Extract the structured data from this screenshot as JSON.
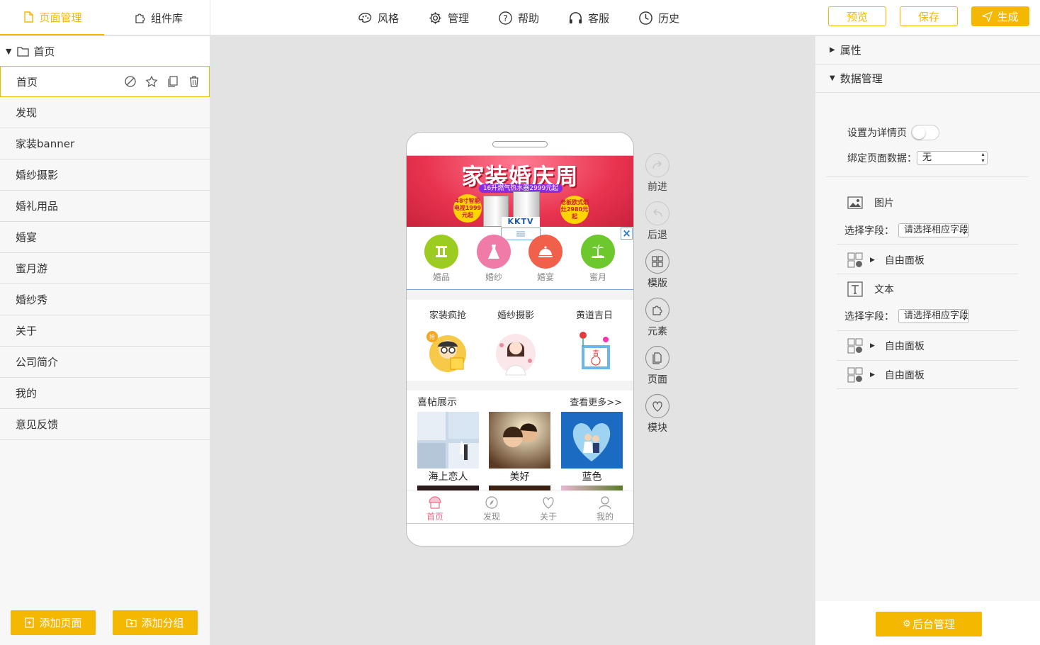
{
  "left_tabs": [
    {
      "label": "页面管理",
      "icon": "file-icon"
    },
    {
      "label": "组件库",
      "icon": "puzzle-icon"
    }
  ],
  "top_nav": [
    {
      "label": "风格",
      "icon": "palette-icon"
    },
    {
      "label": "管理",
      "icon": "gear-icon"
    },
    {
      "label": "帮助",
      "icon": "help-icon"
    },
    {
      "label": "客服",
      "icon": "headset-icon"
    },
    {
      "label": "历史",
      "icon": "clock-icon"
    }
  ],
  "actions": {
    "preview": "预览",
    "save": "保存",
    "generate": "生成"
  },
  "page_tree": {
    "group": "首页",
    "pages": [
      "首页",
      "发现",
      "家装banner",
      "婚纱摄影",
      "婚礼用品",
      "婚宴",
      "蜜月游",
      "婚纱秀",
      "关于",
      "公司简介",
      "我的",
      "意见反馈"
    ],
    "selected": 0
  },
  "left_buttons": {
    "add_page": "添加页面",
    "add_group": "添加分组"
  },
  "phone": {
    "banner": {
      "title": "家装婚庆周",
      "subtitle": "16升燃气热水器2999元起",
      "badge_left": "48寸智能电视1999元起",
      "badge_right": "老板欧式烟灶2980元起",
      "kktv": "KKTV"
    },
    "categories": [
      {
        "label": "婚品",
        "color": "#9ccc1f"
      },
      {
        "label": "婚纱",
        "color": "#f07aa8"
      },
      {
        "label": "婚宴",
        "color": "#f0604a"
      },
      {
        "label": "蜜月",
        "color": "#6cc82d"
      }
    ],
    "features": [
      "家装疯抢",
      "婚纱摄影",
      "黄道吉日"
    ],
    "feature_badge": "抢",
    "calendar_char": "吉",
    "showcase": {
      "title": "喜帖展示",
      "more": "查看更多>>",
      "items": [
        "海上恋人",
        "美好",
        "蓝色"
      ]
    },
    "tabbar": [
      "首页",
      "发现",
      "关于",
      "我的"
    ]
  },
  "side_tools": [
    {
      "label": "前进",
      "icon": "redo-icon",
      "enabled": false
    },
    {
      "label": "后退",
      "icon": "undo-icon",
      "enabled": false
    },
    {
      "label": "模版",
      "icon": "grid-icon",
      "enabled": true
    },
    {
      "label": "元素",
      "icon": "puzzle-icon",
      "enabled": true
    },
    {
      "label": "页面",
      "icon": "pages-icon",
      "enabled": true
    },
    {
      "label": "模块",
      "icon": "heart-icon",
      "enabled": true
    }
  ],
  "right_panel": {
    "sections": [
      "属性",
      "数据管理"
    ],
    "detail_label": "设置为详情页",
    "bind_label": "绑定页面数据：",
    "bind_value": "无",
    "image_label": "图片",
    "text_label": "文本",
    "field_label": "选择字段：",
    "field_placeholder": "请选择相应字段",
    "free_panel": "自由面板",
    "backend": "后台管理"
  },
  "colors": {
    "accent": "#f5b800"
  }
}
